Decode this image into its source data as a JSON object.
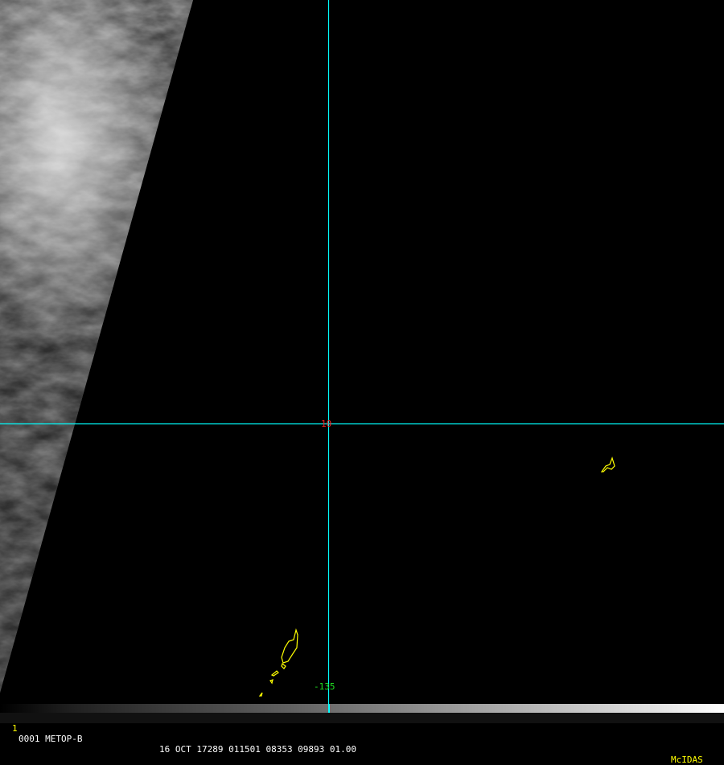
{
  "image": {
    "grid": {
      "latitude_label": "10",
      "longitude_label": "-135"
    },
    "colors": {
      "grid": "#00ffff",
      "coast": "#ffff00",
      "lat_label": "#ff2020",
      "lon_label": "#20e020"
    }
  },
  "infobar": {
    "frame_number": "1",
    "satellite": "0001 METOP-B",
    "stats": "16 OCT 17289 011501 08353 09893 01.00",
    "brand": "McIDAS"
  }
}
